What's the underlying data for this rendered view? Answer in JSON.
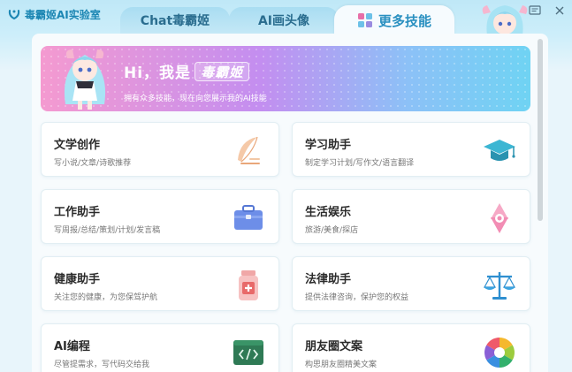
{
  "app": {
    "title": "毒霸姬AI实验室"
  },
  "tabs": [
    {
      "label": "Chat毒霸姬",
      "active": false
    },
    {
      "label": "AI画头像",
      "active": false
    },
    {
      "label": "更多技能",
      "active": true
    }
  ],
  "banner": {
    "greeting": "Hi，我是",
    "name": "毒霸姬",
    "subtitle": "拥有众多技能，现在向您展示我的AI技能"
  },
  "cards": [
    {
      "title": "文学创作",
      "desc": "写小说/文章/诗歌推荐",
      "icon": "feather-quill-icon"
    },
    {
      "title": "学习助手",
      "desc": "制定学习计划/写作文/语言翻译",
      "icon": "graduation-cap-icon"
    },
    {
      "title": "工作助手",
      "desc": "写周报/总结/策划/计划/发言稿",
      "icon": "briefcase-icon"
    },
    {
      "title": "生活娱乐",
      "desc": "旅游/美食/探店",
      "icon": "hexagram-star-icon"
    },
    {
      "title": "健康助手",
      "desc": "关注您的健康，为您保驾护航",
      "icon": "medicine-bottle-icon"
    },
    {
      "title": "法律助手",
      "desc": "提供法律咨询，保护您的权益",
      "icon": "balance-scale-icon"
    },
    {
      "title": "AI编程",
      "desc": "尽管提需求，写代码交给我",
      "icon": "code-terminal-icon"
    },
    {
      "title": "朋友圈文案",
      "desc": "构思朋友圈精美文案",
      "icon": "color-aperture-icon"
    }
  ],
  "colors": {
    "accent": "#2a90c0",
    "banner_start": "#f49ad0",
    "banner_end": "#6fd3f3"
  }
}
